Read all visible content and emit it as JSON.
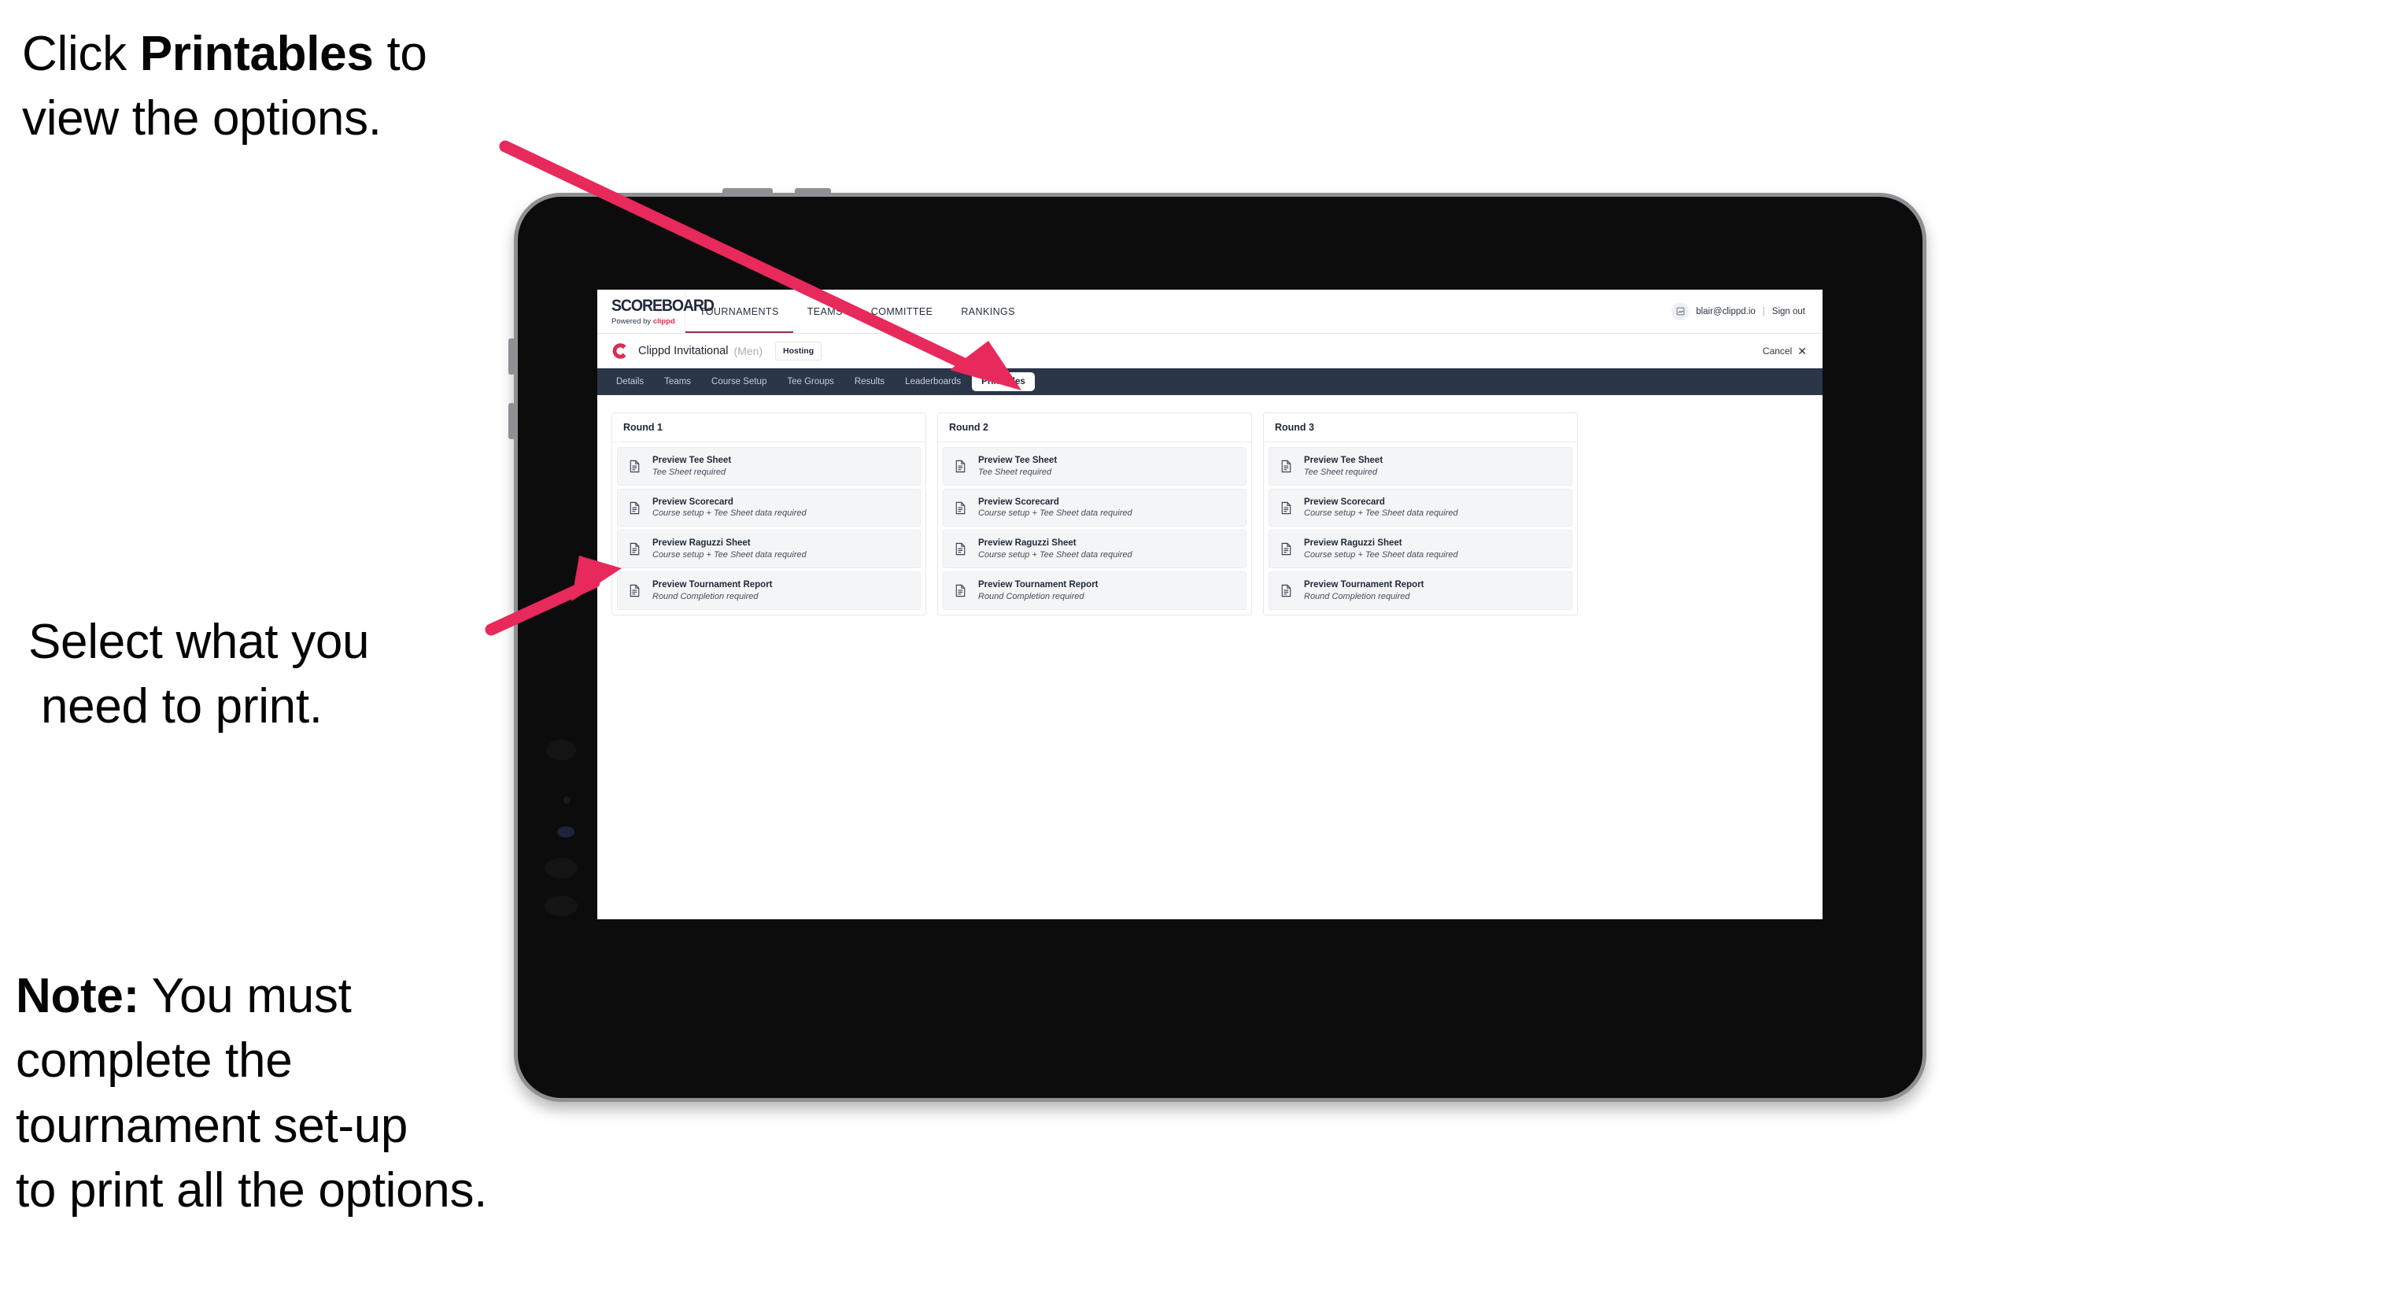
{
  "annotations": {
    "step1": {
      "prefix": "Click ",
      "bold": "Printables",
      "suffix": " to",
      "line2": "view the options."
    },
    "step2": {
      "line1": "Select what you",
      "line2": "need to print."
    },
    "note": {
      "bold": "Note:",
      "line1": " You must",
      "line2": "complete the",
      "line3": "tournament set-up",
      "line4": "to print all the options."
    }
  },
  "app": {
    "brand": {
      "name": "SCOREBOARD",
      "powered_prefix": "Powered by ",
      "powered_brand": "clippd"
    },
    "top_nav": [
      {
        "label": "TOURNAMENTS",
        "active": true
      },
      {
        "label": "TEAMS",
        "active": false
      },
      {
        "label": "COMMITTEE",
        "active": false
      },
      {
        "label": "RANKINGS",
        "active": false
      }
    ],
    "account": {
      "email": "blair@clippd.io",
      "separator": "|",
      "sign_out": "Sign out",
      "avatar_icon": "user-avatar-icon"
    },
    "tournament": {
      "logo_icon": "clippd-c-logo",
      "title": "Clippd Invitational",
      "gender": "(Men)",
      "status_badge": "Hosting",
      "cancel_label": "Cancel",
      "cancel_icon": "close-x-icon"
    },
    "section_nav": [
      {
        "label": "Details",
        "active": false
      },
      {
        "label": "Teams",
        "active": false
      },
      {
        "label": "Course Setup",
        "active": false
      },
      {
        "label": "Tee Groups",
        "active": false
      },
      {
        "label": "Results",
        "active": false
      },
      {
        "label": "Leaderboards",
        "active": false
      },
      {
        "label": "Printables",
        "active": true
      }
    ],
    "rounds": [
      {
        "title": "Round 1",
        "items": [
          {
            "icon": "document-icon",
            "title": "Preview Tee Sheet",
            "requirement": "Tee Sheet required"
          },
          {
            "icon": "document-icon",
            "title": "Preview Scorecard",
            "requirement": "Course setup + Tee Sheet data required"
          },
          {
            "icon": "document-icon",
            "title": "Preview Raguzzi Sheet",
            "requirement": "Course setup + Tee Sheet data required"
          },
          {
            "icon": "document-icon",
            "title": "Preview Tournament Report",
            "requirement": "Round Completion required"
          }
        ]
      },
      {
        "title": "Round 2",
        "items": [
          {
            "icon": "document-icon",
            "title": "Preview Tee Sheet",
            "requirement": "Tee Sheet required"
          },
          {
            "icon": "document-icon",
            "title": "Preview Scorecard",
            "requirement": "Course setup + Tee Sheet data required"
          },
          {
            "icon": "document-icon",
            "title": "Preview Raguzzi Sheet",
            "requirement": "Course setup + Tee Sheet data required"
          },
          {
            "icon": "document-icon",
            "title": "Preview Tournament Report",
            "requirement": "Round Completion required"
          }
        ]
      },
      {
        "title": "Round 3",
        "items": [
          {
            "icon": "document-icon",
            "title": "Preview Tee Sheet",
            "requirement": "Tee Sheet required"
          },
          {
            "icon": "document-icon",
            "title": "Preview Scorecard",
            "requirement": "Course setup + Tee Sheet data required"
          },
          {
            "icon": "document-icon",
            "title": "Preview Raguzzi Sheet",
            "requirement": "Course setup + Tee Sheet data required"
          },
          {
            "icon": "document-icon",
            "title": "Preview Tournament Report",
            "requirement": "Round Completion required"
          }
        ]
      }
    ]
  },
  "colors": {
    "accent_pink": "#e8295b",
    "nav_dark": "#2b3648",
    "brand_navy": "#222a3a",
    "bezel": "#0c0c0c",
    "bezel_edge": "#8e9094",
    "card_bg": "#f4f5f7"
  }
}
